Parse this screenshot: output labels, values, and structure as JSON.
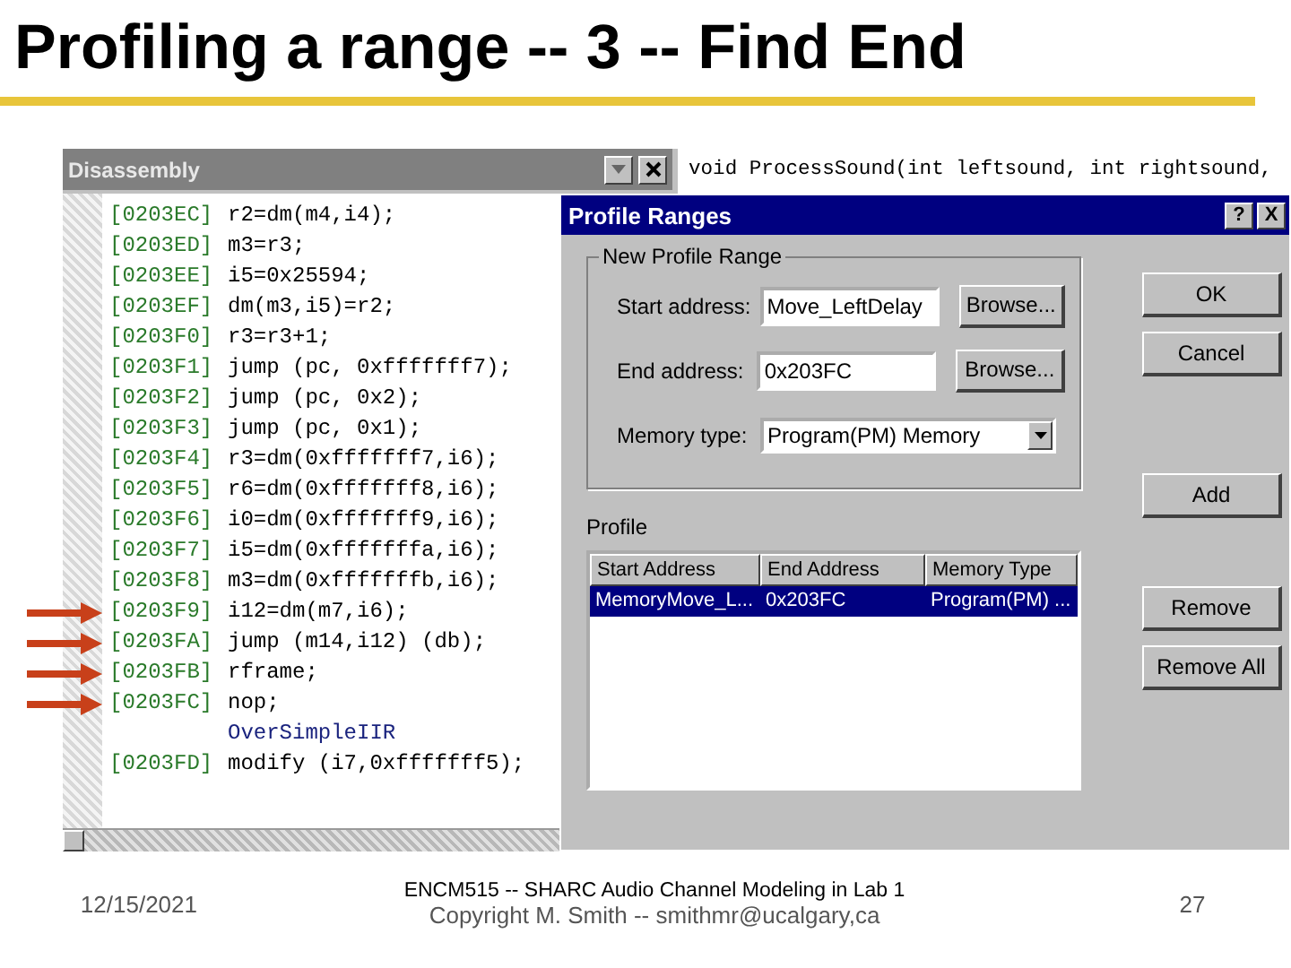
{
  "slide_title": "Profiling a range -- 3 -- Find End",
  "disassembly": {
    "title": "Disassembly",
    "lines": [
      {
        "kind": "code",
        "address": "[0203EC]",
        "code": "r2=dm(m4,i4);"
      },
      {
        "kind": "code",
        "address": "[0203ED]",
        "code": "m3=r3;"
      },
      {
        "kind": "code",
        "address": "[0203EE]",
        "code": "i5=0x25594;"
      },
      {
        "kind": "code",
        "address": "[0203EF]",
        "code": "dm(m3,i5)=r2;"
      },
      {
        "kind": "code",
        "address": "[0203F0]",
        "code": "r3=r3+1;"
      },
      {
        "kind": "code",
        "address": "[0203F1]",
        "code": "jump (pc, 0xfffffff7);"
      },
      {
        "kind": "code",
        "address": "[0203F2]",
        "code": "jump (pc, 0x2);"
      },
      {
        "kind": "code",
        "address": "[0203F3]",
        "code": "jump (pc, 0x1);"
      },
      {
        "kind": "code",
        "address": "[0203F4]",
        "code": "r3=dm(0xfffffff7,i6);"
      },
      {
        "kind": "code",
        "address": "[0203F5]",
        "code": "r6=dm(0xfffffff8,i6);"
      },
      {
        "kind": "code",
        "address": "[0203F6]",
        "code": "i0=dm(0xfffffff9,i6);"
      },
      {
        "kind": "code",
        "address": "[0203F7]",
        "code": "i5=dm(0xfffffffa,i6);"
      },
      {
        "kind": "code",
        "address": "[0203F8]",
        "code": "m3=dm(0xfffffffb,i6);"
      },
      {
        "kind": "code",
        "address": "[0203F9]",
        "code": "i12=dm(m7,i6);",
        "arrow": true
      },
      {
        "kind": "code",
        "address": "[0203FA]",
        "code": "jump (m14,i12) (db);",
        "arrow": true
      },
      {
        "kind": "code",
        "address": "[0203FB]",
        "code": "rframe;",
        "arrow": true
      },
      {
        "kind": "code",
        "address": "[0203FC]",
        "code": "nop;",
        "arrow": true
      },
      {
        "kind": "label",
        "code": "OverSimpleIIR"
      },
      {
        "kind": "code",
        "address": "[0203FD]",
        "code": "modify (i7,0xfffffff5);"
      }
    ]
  },
  "source_line": "void ProcessSound(int leftsound, int rightsound,",
  "dialog": {
    "title": "Profile Ranges",
    "help": "?",
    "close": "X",
    "group_title": "New Profile Range",
    "fields": [
      {
        "kind": "input",
        "label": "Start address:",
        "value": "Move_LeftDelay",
        "button": "Browse..."
      },
      {
        "kind": "input",
        "label": "End address:",
        "value": "0x203FC",
        "button": "Browse..."
      },
      {
        "kind": "select",
        "label": "Memory type:",
        "value": "Program(PM) Memory"
      }
    ],
    "profile_label": "Profile",
    "columns": [
      "Start Address",
      "End Address",
      "Memory Type"
    ],
    "rows": [
      {
        "cells": [
          "MemoryMove_L...",
          "0x203FC",
          "Program(PM) ..."
        ],
        "selected": true
      }
    ],
    "buttons": [
      "OK",
      "Cancel",
      "Add",
      "Remove",
      "Remove All"
    ]
  },
  "footer": {
    "date": "12/15/2021",
    "course": "ENCM515 -- SHARC Audio Channel Modeling in  Lab 1",
    "copyright": "Copyright M. Smith -- smithmr@ucalgary,ca",
    "page": "27"
  }
}
